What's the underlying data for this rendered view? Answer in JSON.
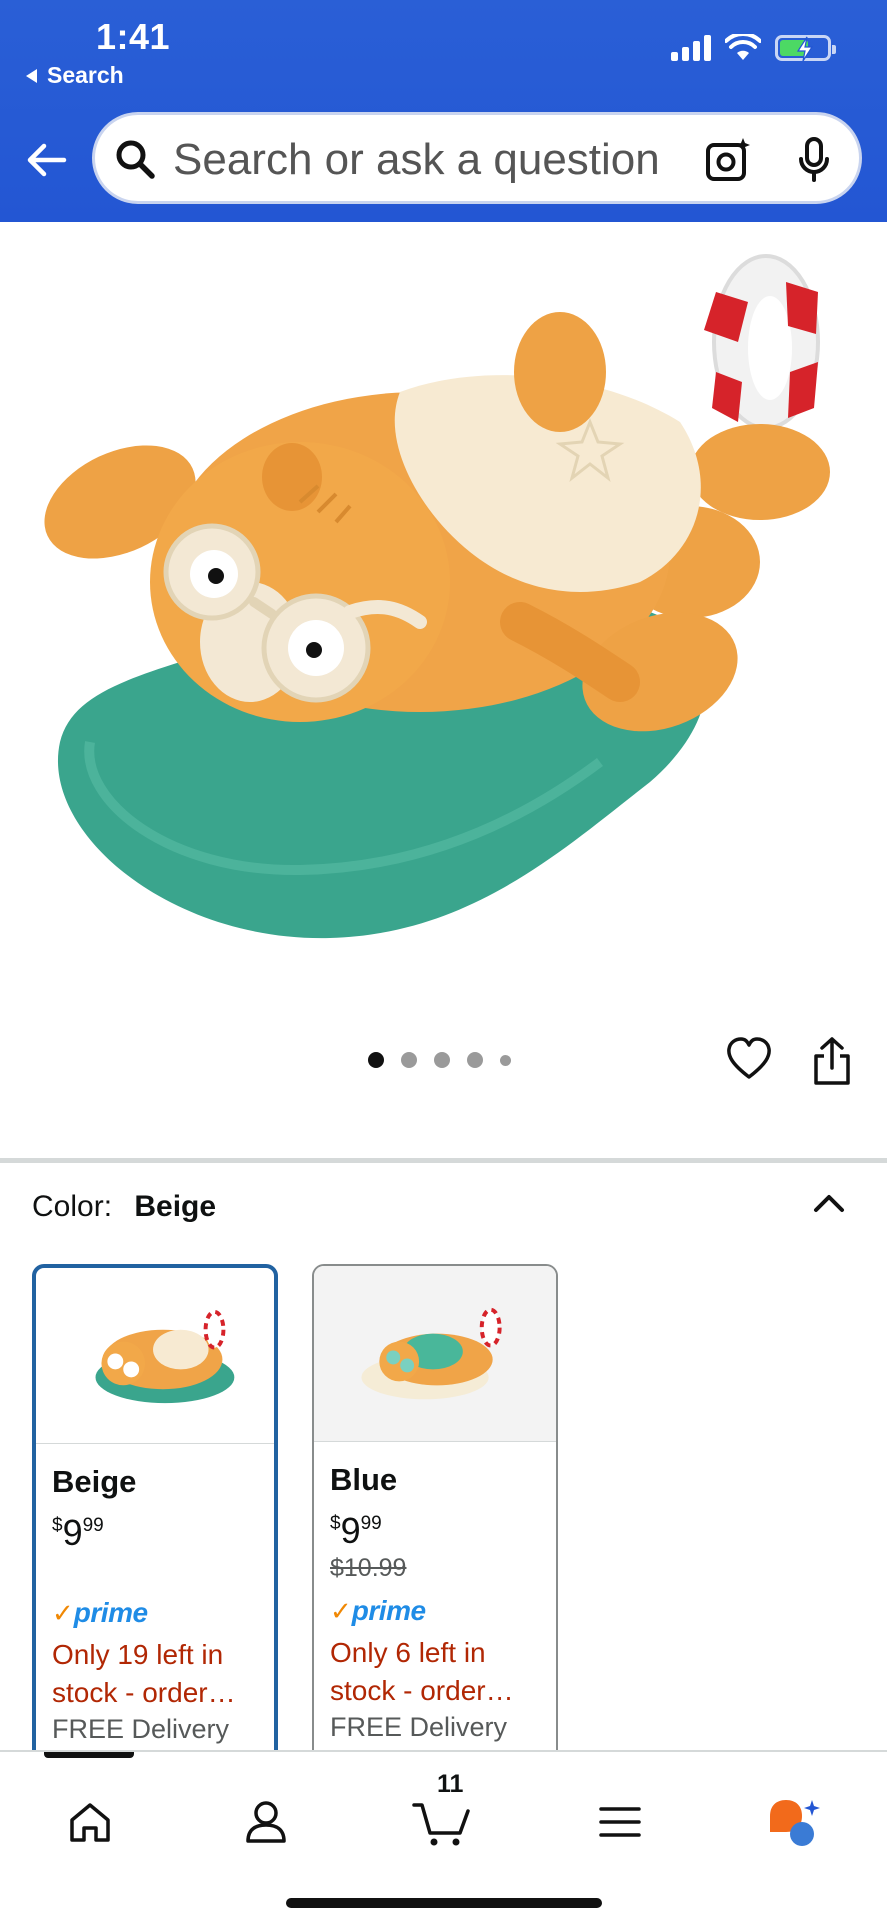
{
  "status_bar": {
    "time": "1:41",
    "back_app": "Search"
  },
  "search": {
    "placeholder": "Search or ask a question"
  },
  "gallery": {
    "image_count": 5,
    "active_index": 0
  },
  "variation": {
    "label": "Color:",
    "selected": "Beige"
  },
  "options": [
    {
      "name": "Beige",
      "currency": "$",
      "price_whole": "9",
      "price_fraction": "99",
      "list_price": "",
      "prime": "prime",
      "stock": "Only 19 left in stock - order…",
      "delivery": "FREE Delivery"
    },
    {
      "name": "Blue",
      "currency": "$",
      "price_whole": "9",
      "price_fraction": "99",
      "list_price": "$10.99",
      "prime": "prime",
      "stock": "Only 6 left in stock - order…",
      "delivery": "FREE Delivery"
    }
  ],
  "tabbar": {
    "cart_count": "11",
    "items": [
      "home-icon",
      "account-icon",
      "cart-icon",
      "menu-icon",
      "rufus-icon"
    ]
  },
  "colors": {
    "header_blue": "#2356d3",
    "price_red": "#b12704",
    "prime_blue": "#1f8ce6",
    "prime_check": "#f08804",
    "selected_border": "#2162a1"
  }
}
